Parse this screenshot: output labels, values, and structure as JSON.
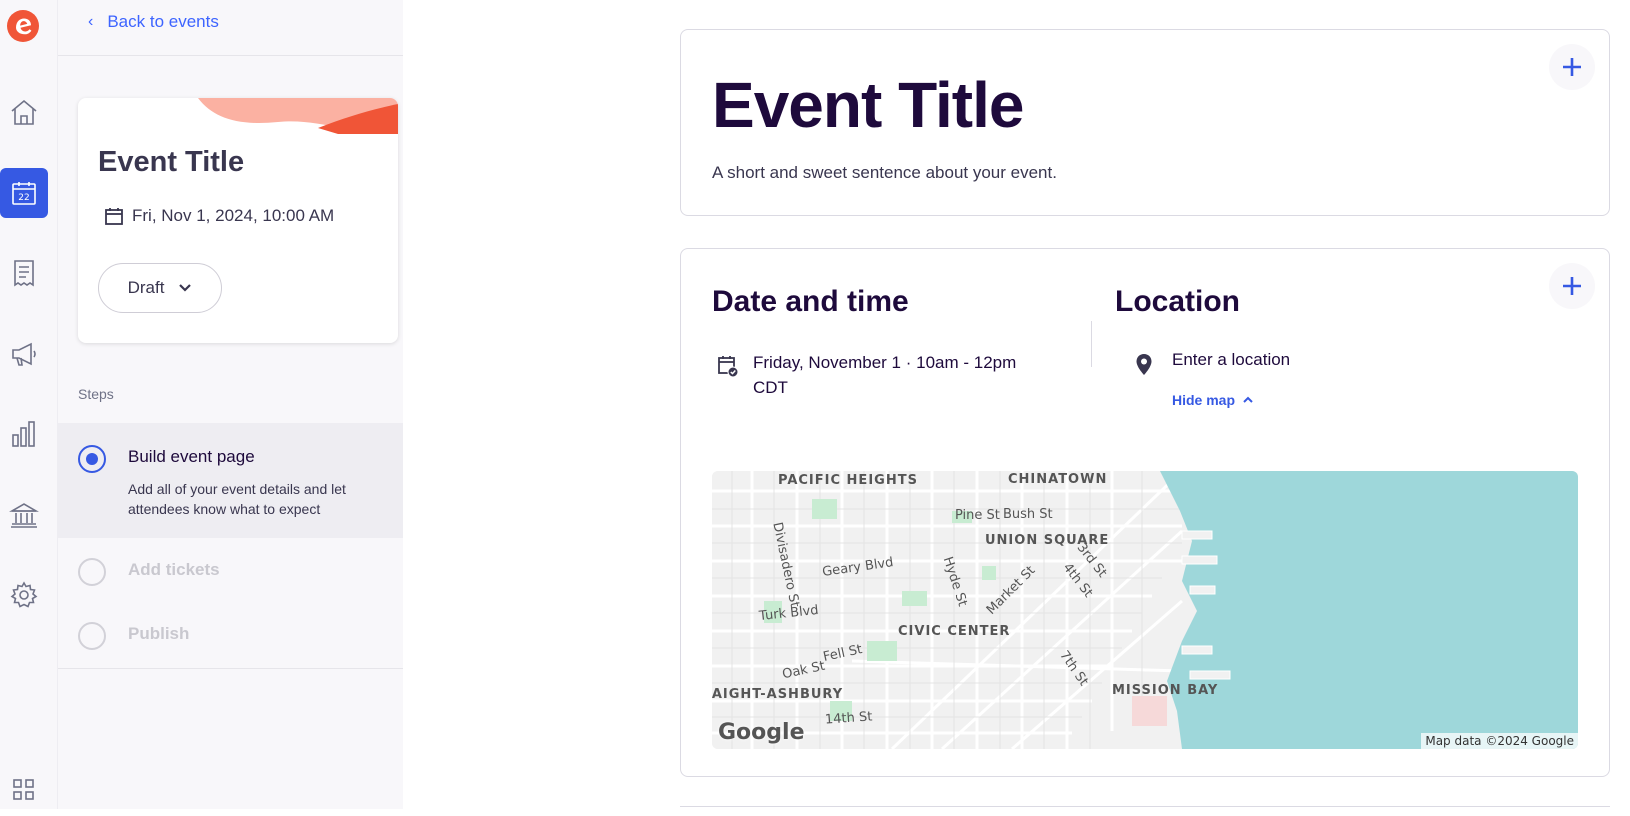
{
  "nav": {
    "back_label": "Back to events",
    "back_chevron": "‹"
  },
  "rail": {
    "calendar_day": "22",
    "icons": [
      "eventbrite-logo-icon",
      "home-icon",
      "calendar-icon",
      "orders-icon",
      "marketing-icon",
      "reports-icon",
      "finance-icon",
      "settings-icon",
      "apps-grid-icon"
    ]
  },
  "event_card": {
    "title": "Event Title",
    "date": "Fri, Nov 1, 2024, 10:00 AM",
    "status": "Draft"
  },
  "steps": {
    "heading": "Steps",
    "items": [
      {
        "label": "Build event page",
        "description": "Add all of your event details and let attendees know what to expect",
        "state": "active"
      },
      {
        "label": "Add tickets",
        "state": "disabled"
      },
      {
        "label": "Publish",
        "state": "disabled"
      }
    ]
  },
  "main": {
    "event_title": "Event Title",
    "summary": "A short and sweet sentence about your event.",
    "date_heading": "Date and time",
    "date_value": "Friday, November 1 · 10am - 12pm CDT",
    "location_heading": "Location",
    "location_placeholder": "Enter a location",
    "hide_map_label": "Hide map",
    "add_icon": "+"
  },
  "map": {
    "labels": [
      "PACIFIC HEIGHTS",
      "CHINATOWN",
      "Pine St",
      "Bush St",
      "UNION SQUARE",
      "Divisadero St",
      "Geary Blvd",
      "Hyde St",
      "3rd St",
      "4th St",
      "Market St",
      "Turk Blvd",
      "CIVIC CENTER",
      "Fell St",
      "Oak St",
      "7th St",
      "MISSION BAY",
      "IAIGHT-ASHBURY",
      "14th St"
    ],
    "logo": "Google",
    "attribution": "Map data ©2024 Google"
  },
  "colors": {
    "brand": "#f05537",
    "accent": "#3659e3",
    "link": "#3d64ff",
    "water": "#9ed7da",
    "title": "#1e0a3c"
  }
}
